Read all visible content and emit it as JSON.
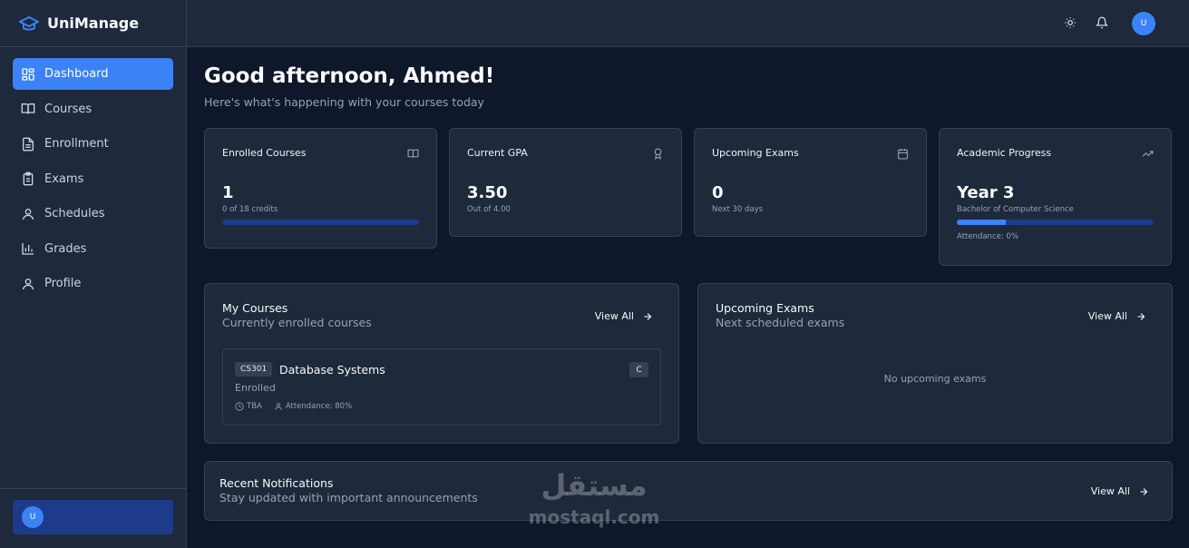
{
  "app": {
    "name": "UniManage"
  },
  "sidebar": {
    "items": [
      {
        "label": "Dashboard",
        "icon": "dashboard-icon",
        "active": true
      },
      {
        "label": "Courses",
        "icon": "book-icon"
      },
      {
        "label": "Enrollment",
        "icon": "document-icon"
      },
      {
        "label": "Exams",
        "icon": "clipboard-icon"
      },
      {
        "label": "Schedules",
        "icon": "user-icon"
      },
      {
        "label": "Grades",
        "icon": "bar-chart-icon"
      },
      {
        "label": "Profile",
        "icon": "user-icon"
      }
    ],
    "user_initial": "U"
  },
  "topbar": {
    "user_initial": "U"
  },
  "greeting": {
    "title": "Good afternoon, Ahmed!",
    "subtitle": "Here's what's happening with your courses today"
  },
  "stats": {
    "enrolled": {
      "title": "Enrolled Courses",
      "value": "1",
      "sub": "0 of 18 credits",
      "progress": 0
    },
    "gpa": {
      "title": "Current GPA",
      "value": "3.50",
      "sub": "Out of 4.00"
    },
    "exams": {
      "title": "Upcoming Exams",
      "value": "0",
      "sub": "Next 30 days"
    },
    "progress": {
      "title": "Academic Progress",
      "value": "Year 3",
      "sub": "Bachelor of Computer Science",
      "progress": 0.25,
      "note": "Attendance: 0%"
    }
  },
  "my_courses": {
    "title": "My Courses",
    "subtitle": "Currently enrolled courses",
    "view_all": "View All",
    "course": {
      "code": "CS301",
      "name": "Database Systems",
      "grade": "C",
      "status": "Enrolled",
      "schedule": "TBA",
      "attendance": "Attendance: 80%"
    }
  },
  "upcoming_exams": {
    "title": "Upcoming Exams",
    "subtitle": "Next scheduled exams",
    "view_all": "View All",
    "empty": "No upcoming exams"
  },
  "notifications": {
    "title": "Recent Notifications",
    "subtitle": "Stay updated with important announcements",
    "view_all": "View All"
  },
  "watermark": {
    "arabic": "مستقل",
    "latin": "mostaql.com"
  },
  "colors": {
    "accent": "#3b82f6",
    "background": "#0f172a",
    "surface": "#1e293b",
    "border": "#334155"
  }
}
